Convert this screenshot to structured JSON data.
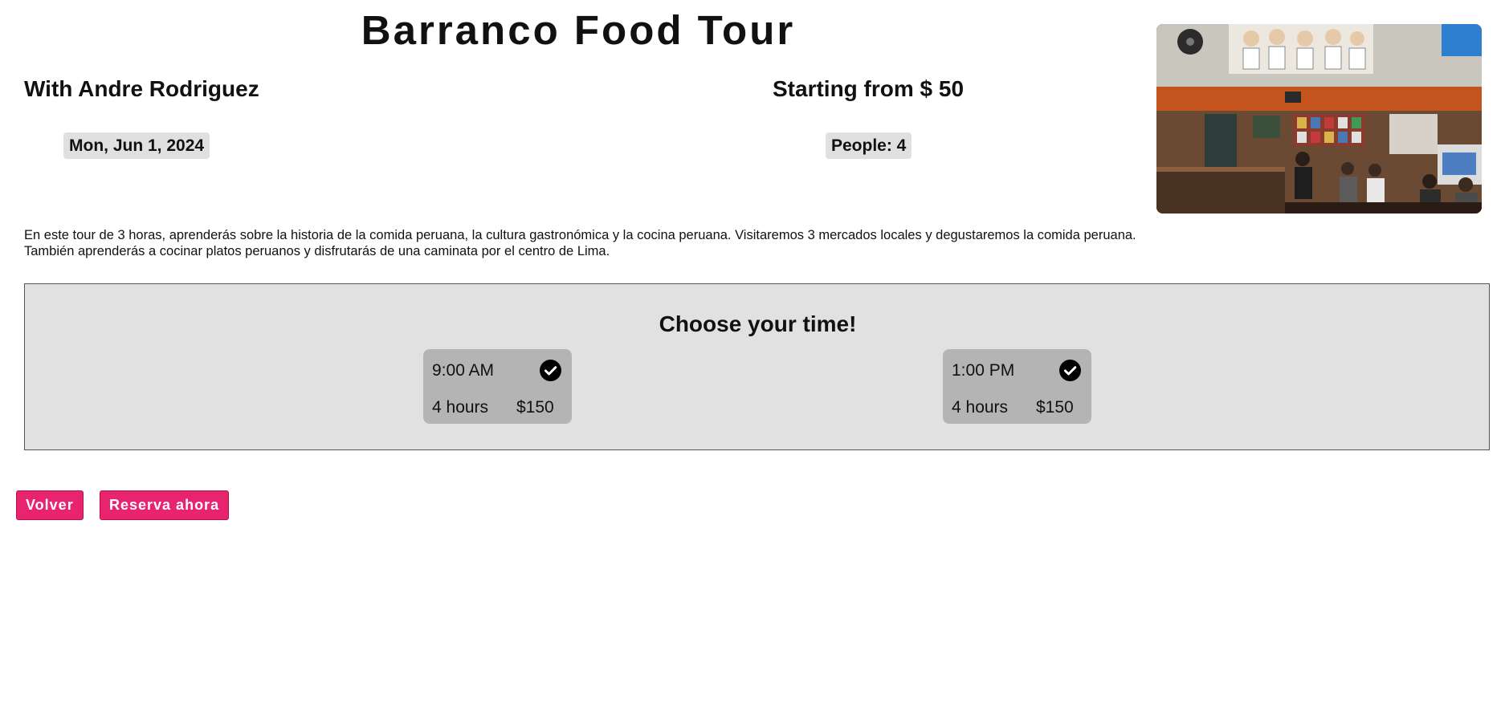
{
  "tour": {
    "title": "Barranco Food Tour",
    "guide": "With Andre Rodriguez",
    "price_from": "Starting from $ 50",
    "date": "Mon, Jun 1, 2024",
    "people": "People: 4",
    "description": "En este tour de 3 horas, aprenderás sobre la historia de la comida peruana, la cultura gastronómica y la cocina peruana. Visitaremos 3 mercados locales y degustaremos la comida peruana. También aprenderás a cocinar platos peruanos y disfrutarás de una caminata por el centro de Lima."
  },
  "time_picker": {
    "heading": "Choose your time!",
    "slots": [
      {
        "time": "9:00 AM",
        "duration": "4 hours",
        "price": "$150",
        "icon": "check-circle-icon"
      },
      {
        "time": "1:00 PM",
        "duration": "4 hours",
        "price": "$150",
        "icon": "check-circle-icon"
      }
    ]
  },
  "actions": {
    "back_label": "Volver",
    "book_label": "Reserva ahora"
  },
  "colors": {
    "accent": "#e8246f",
    "panel_bg": "#e1e1e1",
    "slot_bg": "#b4b4b4",
    "chip_bg": "#e0e0e0"
  }
}
